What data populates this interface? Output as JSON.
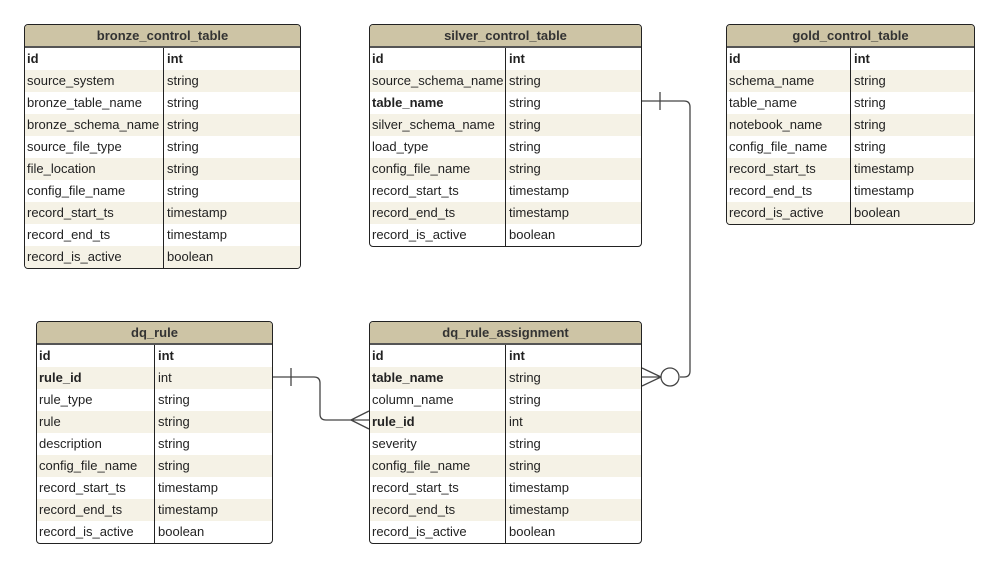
{
  "tables": [
    {
      "id": "bronze",
      "title": "bronze_control_table",
      "rows": [
        {
          "name": "id",
          "type": "int",
          "bold": true,
          "typeBold": true
        },
        {
          "name": "source_system",
          "type": "string"
        },
        {
          "name": "bronze_table_name",
          "type": "string"
        },
        {
          "name": "bronze_schema_name",
          "type": "string"
        },
        {
          "name": "source_file_type",
          "type": "string"
        },
        {
          "name": "file_location",
          "type": "string"
        },
        {
          "name": "config_file_name",
          "type": "string"
        },
        {
          "name": "record_start_ts",
          "type": "timestamp"
        },
        {
          "name": "record_end_ts",
          "type": "timestamp"
        },
        {
          "name": "record_is_active",
          "type": "boolean"
        }
      ]
    },
    {
      "id": "silver",
      "title": "silver_control_table",
      "rows": [
        {
          "name": "id",
          "type": "int",
          "bold": true,
          "typeBold": true
        },
        {
          "name": "source_schema_name",
          "type": "string"
        },
        {
          "name": "table_name",
          "type": "string",
          "bold": true
        },
        {
          "name": "silver_schema_name",
          "type": "string"
        },
        {
          "name": "load_type",
          "type": "string"
        },
        {
          "name": "config_file_name",
          "type": "string"
        },
        {
          "name": "record_start_ts",
          "type": "timestamp"
        },
        {
          "name": "record_end_ts",
          "type": "timestamp"
        },
        {
          "name": "record_is_active",
          "type": "boolean"
        }
      ]
    },
    {
      "id": "gold",
      "title": "gold_control_table",
      "rows": [
        {
          "name": "id",
          "type": "int",
          "bold": true,
          "typeBold": true
        },
        {
          "name": "schema_name",
          "type": "string"
        },
        {
          "name": "table_name",
          "type": "string"
        },
        {
          "name": "notebook_name",
          "type": "string"
        },
        {
          "name": "config_file_name",
          "type": "string"
        },
        {
          "name": "record_start_ts",
          "type": "timestamp"
        },
        {
          "name": "record_end_ts",
          "type": "timestamp"
        },
        {
          "name": "record_is_active",
          "type": "boolean"
        }
      ]
    },
    {
      "id": "dq_rule",
      "title": "dq_rule",
      "rows": [
        {
          "name": "id",
          "type": "int",
          "bold": true,
          "typeBold": true
        },
        {
          "name": "rule_id",
          "type": "int",
          "bold": true
        },
        {
          "name": "rule_type",
          "type": "string"
        },
        {
          "name": "rule",
          "type": "string"
        },
        {
          "name": "description",
          "type": "string"
        },
        {
          "name": "config_file_name",
          "type": "string"
        },
        {
          "name": "record_start_ts",
          "type": "timestamp"
        },
        {
          "name": "record_end_ts",
          "type": "timestamp"
        },
        {
          "name": "record_is_active",
          "type": "boolean"
        }
      ]
    },
    {
      "id": "dq_rule_assignment",
      "title": "dq_rule_assignment",
      "rows": [
        {
          "name": "id",
          "type": "int",
          "bold": true,
          "typeBold": true
        },
        {
          "name": "table_name",
          "type": "string",
          "bold": true
        },
        {
          "name": "column_name",
          "type": "string"
        },
        {
          "name": "rule_id",
          "type": "int",
          "bold": true
        },
        {
          "name": "severity",
          "type": "string"
        },
        {
          "name": "config_file_name",
          "type": "string"
        },
        {
          "name": "record_start_ts",
          "type": "timestamp"
        },
        {
          "name": "record_end_ts",
          "type": "timestamp"
        },
        {
          "name": "record_is_active",
          "type": "boolean"
        }
      ]
    }
  ],
  "relationships": [
    {
      "from": "silver_control_table.table_name",
      "to": "dq_rule_assignment.table_name",
      "cardinality": "one-to-zero-or-many"
    },
    {
      "from": "dq_rule.rule_id",
      "to": "dq_rule_assignment.rule_id",
      "cardinality": "one-to-many"
    }
  ],
  "colors": {
    "header": "#cdc4a5",
    "alt_row": "#f5f2e6",
    "border": "#222222"
  }
}
